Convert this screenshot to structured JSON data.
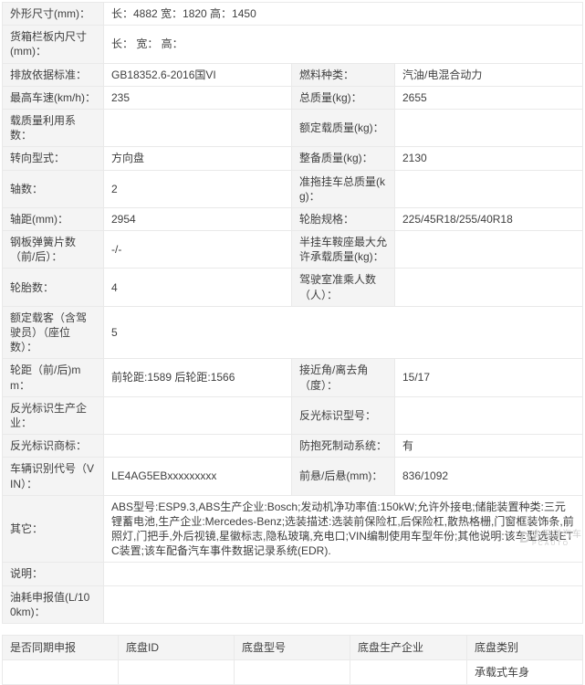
{
  "colors": {
    "label_bg": "#f4f4f4",
    "border": "#e9e9e9",
    "text": "#3f3f3f",
    "watermark": "#cfcfcf"
  },
  "spec_table": {
    "rows": [
      {
        "cells": [
          {
            "k": "label",
            "t": "外形尺寸(mm)："
          },
          {
            "k": "value",
            "t": "长：4882 宽：1820 高：1450",
            "span": 3
          }
        ]
      },
      {
        "cells": [
          {
            "k": "label",
            "t": "货箱栏板内尺寸(mm)："
          },
          {
            "k": "value",
            "t": "长： 宽： 高：",
            "span": 3
          }
        ]
      },
      {
        "cells": [
          {
            "k": "label",
            "t": "排放依据标准："
          },
          {
            "k": "value",
            "t": "GB18352.6-2016国VI"
          },
          {
            "k": "label",
            "t": "燃料种类："
          },
          {
            "k": "value",
            "t": "汽油/电混合动力"
          }
        ]
      },
      {
        "cells": [
          {
            "k": "label",
            "t": "最高车速(km/h)："
          },
          {
            "k": "value",
            "t": "235"
          },
          {
            "k": "label",
            "t": "总质量(kg)："
          },
          {
            "k": "value",
            "t": "2655"
          }
        ]
      },
      {
        "cells": [
          {
            "k": "label",
            "t": "载质量利用系数："
          },
          {
            "k": "value",
            "t": ""
          },
          {
            "k": "label",
            "t": "额定载质量(kg)："
          },
          {
            "k": "value",
            "t": ""
          }
        ]
      },
      {
        "cells": [
          {
            "k": "label",
            "t": "转向型式："
          },
          {
            "k": "value",
            "t": "方向盘"
          },
          {
            "k": "label",
            "t": "整备质量(kg)："
          },
          {
            "k": "value",
            "t": "2130"
          }
        ]
      },
      {
        "cells": [
          {
            "k": "label",
            "t": "轴数："
          },
          {
            "k": "value",
            "t": "2"
          },
          {
            "k": "label",
            "t": "准拖挂车总质量(kg)："
          },
          {
            "k": "value",
            "t": ""
          }
        ]
      },
      {
        "cells": [
          {
            "k": "label",
            "t": "轴距(mm)："
          },
          {
            "k": "value",
            "t": "2954"
          },
          {
            "k": "label",
            "t": "轮胎规格："
          },
          {
            "k": "value",
            "t": "225/45R18/255/40R18"
          }
        ]
      },
      {
        "cells": [
          {
            "k": "label",
            "t": "钢板弹簧片数（前/后）："
          },
          {
            "k": "value",
            "t": "-/-"
          },
          {
            "k": "label",
            "t": "半挂车鞍座最大允许承载质量(kg)："
          },
          {
            "k": "value",
            "t": ""
          }
        ]
      },
      {
        "cells": [
          {
            "k": "label",
            "t": "轮胎数："
          },
          {
            "k": "value",
            "t": "4"
          },
          {
            "k": "label",
            "t": "驾驶室准乘人数（人）："
          },
          {
            "k": "value",
            "t": ""
          }
        ]
      },
      {
        "cells": [
          {
            "k": "label",
            "t": "额定载客（含驾驶员）（座位数）："
          },
          {
            "k": "value",
            "t": "5",
            "span": 3
          }
        ]
      },
      {
        "cells": [
          {
            "k": "label",
            "t": "轮距（前/后)mm："
          },
          {
            "k": "value",
            "t": "前轮距:1589 后轮距:1566"
          },
          {
            "k": "label",
            "t": "接近角/离去角（度）："
          },
          {
            "k": "value",
            "t": "15/17"
          }
        ]
      },
      {
        "cells": [
          {
            "k": "label",
            "t": "反光标识生产企业："
          },
          {
            "k": "value",
            "t": ""
          },
          {
            "k": "label",
            "t": "反光标识型号："
          },
          {
            "k": "value",
            "t": ""
          }
        ]
      },
      {
        "cells": [
          {
            "k": "label",
            "t": "反光标识商标："
          },
          {
            "k": "value",
            "t": ""
          },
          {
            "k": "label",
            "t": "防抱死制动系统："
          },
          {
            "k": "value",
            "t": "有"
          }
        ]
      },
      {
        "cells": [
          {
            "k": "label",
            "t": "车辆识别代号（VIN）："
          },
          {
            "k": "value",
            "t": "LE4AG5EBxxxxxxxxx"
          },
          {
            "k": "label",
            "t": "前悬/后悬(mm)："
          },
          {
            "k": "value",
            "t": "836/1092"
          }
        ]
      },
      {
        "cells": [
          {
            "k": "label",
            "t": "其它："
          },
          {
            "k": "value",
            "t": "ABS型号:ESP9.3,ABS生产企业:Bosch;发动机净功率值:150kW;允许外接电;储能装置种类:三元锂蓄电池,生产企业:Mercedes-Benz;选装描述:选装前保险杠,后保险杠,散热格栅,门窗框装饰条,前照灯,门把手,外后视镜,星徽标志,隐私玻璃,充电口;VIN编制使用车型年份;其他说明:该车型选装ETC装置;该车配备汽车事件数据记录系统(EDR).",
            "span": 3
          }
        ]
      },
      {
        "cells": [
          {
            "k": "label",
            "t": "说明："
          },
          {
            "k": "value",
            "t": "",
            "span": 3
          }
        ]
      },
      {
        "cells": [
          {
            "k": "label",
            "t": "油耗申报值(L/100km)："
          },
          {
            "k": "value",
            "t": "",
            "span": 3
          }
        ]
      }
    ]
  },
  "chassis_table": {
    "headers": [
      "是否同期申报",
      "底盘ID",
      "底盘型号",
      "底盘生产企业",
      "底盘类别"
    ],
    "row": [
      "",
      "",
      "",
      "",
      "承载式车身"
    ]
  },
  "watermark": {
    "logo_glyph": "D",
    "text": "太平洋汽车",
    "subtext": "PCAUTO"
  }
}
